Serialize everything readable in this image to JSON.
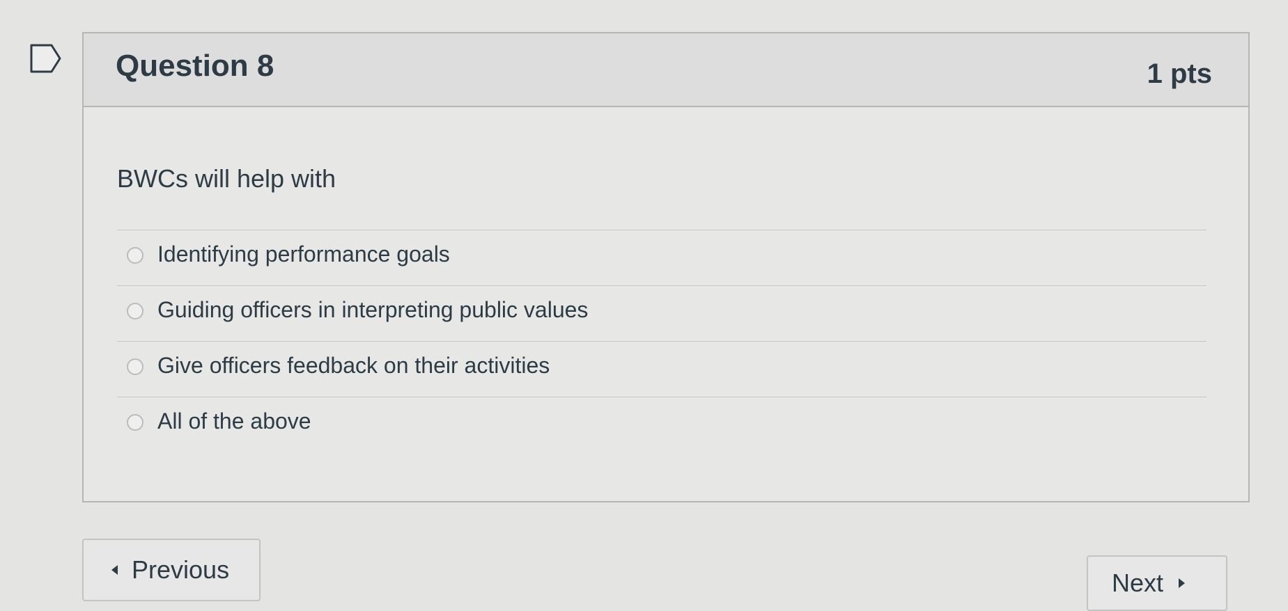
{
  "question": {
    "title": "Question 8",
    "points": "1 pts",
    "text": "BWCs will help with",
    "answers": [
      {
        "label": "Identifying performance goals",
        "selected": false
      },
      {
        "label": "Guiding officers in interpreting public values",
        "selected": false
      },
      {
        "label": "Give officers feedback on their activities",
        "selected": false
      },
      {
        "label": "All of the above",
        "selected": false
      }
    ]
  },
  "navigation": {
    "previous_label": "Previous",
    "next_label": "Next"
  },
  "icons": {
    "bookmark": "bookmark-flag-icon",
    "previous": "caret-left-icon",
    "next": "caret-right-icon"
  },
  "colors": {
    "text": "#2d3b45",
    "border": "#b4b6b6",
    "header_bg": "#dcdddc"
  }
}
